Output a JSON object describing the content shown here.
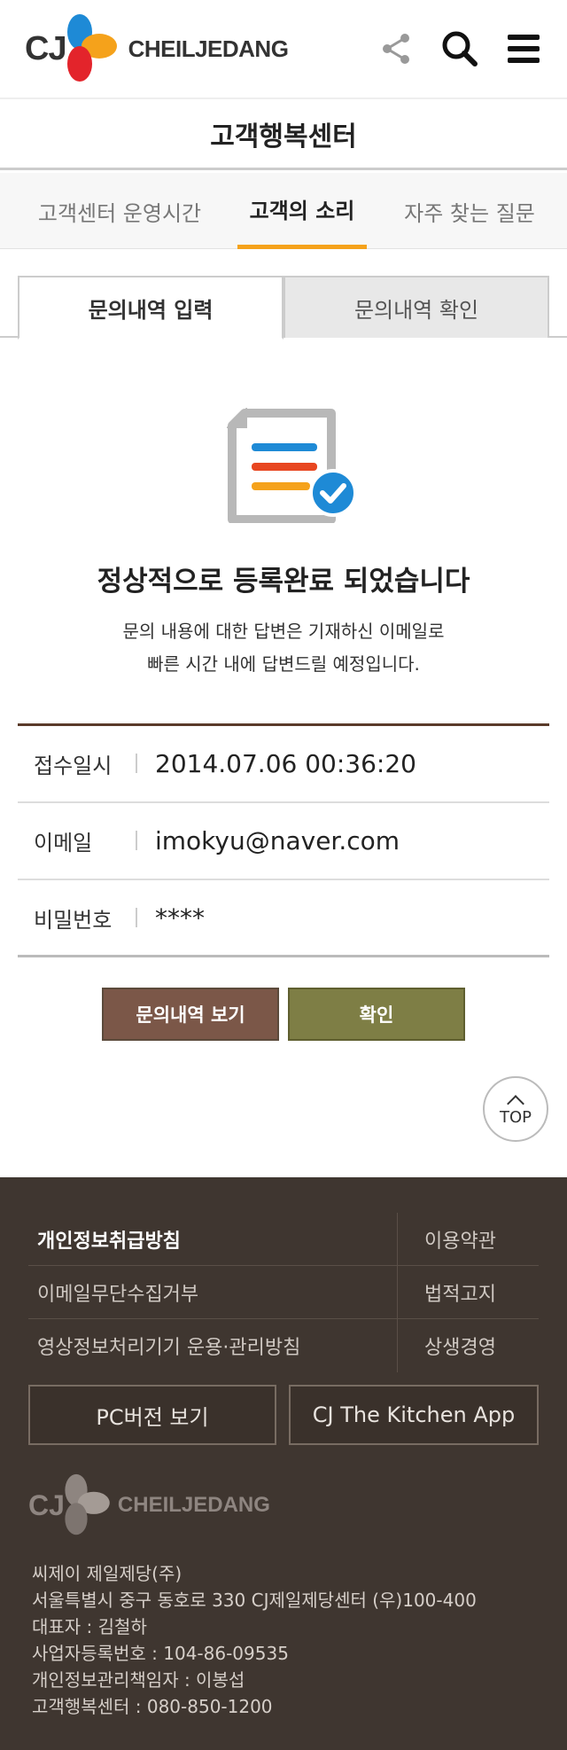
{
  "header": {
    "logo_cj": "CJ",
    "logo_brand": "CHEILJEDANG",
    "icons": [
      "share-icon",
      "search-icon",
      "menu-icon"
    ]
  },
  "page_title": "고객행복센터",
  "tabs": [
    {
      "label": "고객센터 운영시간",
      "active": false
    },
    {
      "label": "고객의 소리",
      "active": true
    },
    {
      "label": "자주 찾는 질문",
      "active": false
    }
  ],
  "subtabs": [
    {
      "label": "문의내역 입력",
      "active": true
    },
    {
      "label": "문의내역 확인",
      "active": false
    }
  ],
  "completion": {
    "title": "정상적으로 등록완료 되었습니다",
    "desc_line1": "문의 내용에 대한 답변은 기재하신 이메일로",
    "desc_line2": "빠른 시간 내에 답변드릴 예정입니다."
  },
  "info": {
    "date_label": "접수일시",
    "date_value": "2014.07.06 00:36:20",
    "email_label": "이메일",
    "email_value": "imokyu@naver.com",
    "pw_label": "비밀번호",
    "pw_value": "****"
  },
  "buttons": {
    "view": "문의내역 보기",
    "confirm": "확인",
    "top": "TOP"
  },
  "footer": {
    "links": [
      {
        "left": "개인정보취급방침",
        "right": "이용약관"
      },
      {
        "left": "이메일무단수집거부",
        "right": "법적고지"
      },
      {
        "left": "영상정보처리기기 운용·관리방침",
        "right": "상생경영"
      }
    ],
    "pc_button": "PC버전 보기",
    "app_button": "CJ The Kitchen App",
    "logo_cj": "CJ",
    "logo_brand": "CHEILJEDANG",
    "company": "씨제이 제일제당(주)",
    "address": "서울특별시 중구 동호로 330 CJ제일제당센터 (우)100-400",
    "ceo": "대표자 : 김철하",
    "biz_no": "사업자등록번호 : 104-86-09535",
    "privacy_officer": "개인정보관리책임자 : 이봉섭",
    "phone": "고객행복센터 : 080-850-1200"
  },
  "colors": {
    "accent_tab": "#f5a21b",
    "view_button": "#7b5748",
    "confirm_button": "#7e7e45",
    "footer_bg": "#3f3630"
  }
}
